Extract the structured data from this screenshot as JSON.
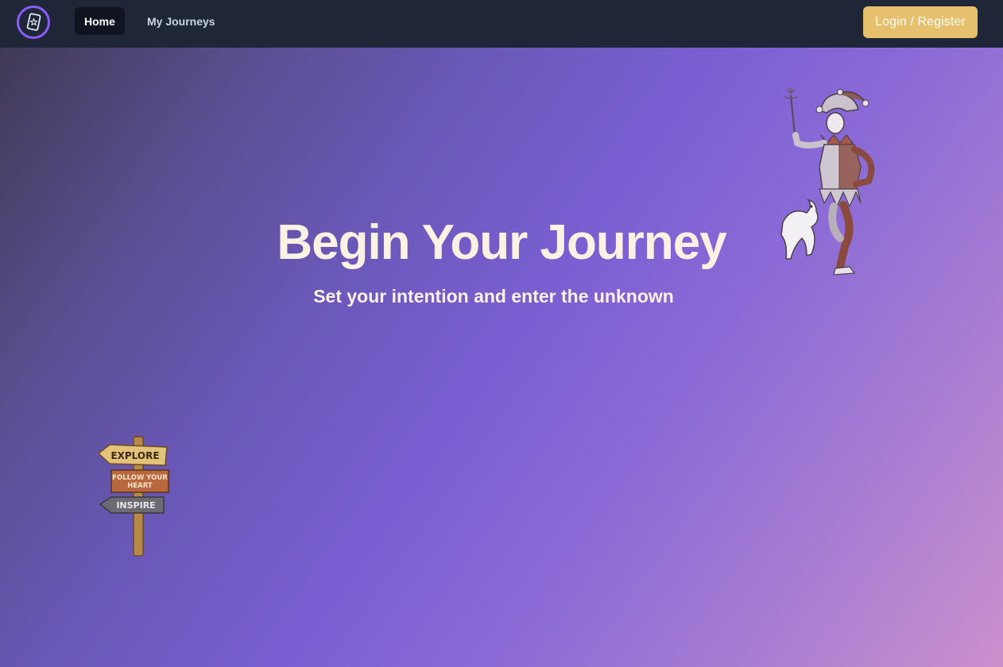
{
  "nav": {
    "home_label": "Home",
    "journeys_label": "My Journeys",
    "login_label": "Login / Register"
  },
  "hero": {
    "title": "Begin Your Journey",
    "subtitle": "Set your intention and enter the unknown"
  },
  "signpost": {
    "sign_top": "EXPLORE",
    "sign_middle_line1": "FOLLOW YOUR",
    "sign_middle_line2": "HEART",
    "sign_bottom": "INSPIRE"
  },
  "icons": {
    "logo": "tarot-card-star-icon",
    "illustration_jester": "jester-with-dog-illustration",
    "illustration_signpost": "signpost-illustration"
  },
  "colors": {
    "navbar_bg": "#1e2637",
    "accent_purple": "#8b5cf6",
    "login_button": "#e6c06c",
    "hero_text": "#fbf2e3"
  }
}
